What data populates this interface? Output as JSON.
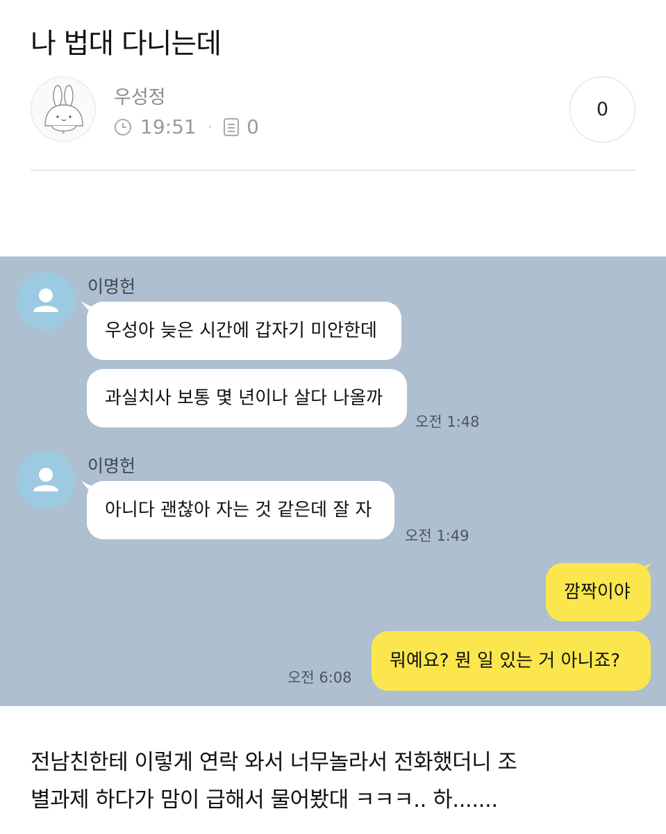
{
  "post": {
    "title": "나 법대 다니는데",
    "author": "우성정",
    "time": "19:51",
    "separator": "·",
    "views": "0",
    "comments": "0"
  },
  "chat": {
    "groups": [
      {
        "sender": "이명헌",
        "messages": [
          "우성아 늦은 시간에 갑자기 미안한데",
          "과실치사 보통 몇 년이나 살다 나올까"
        ],
        "time": "오전 1:48"
      },
      {
        "sender": "이명헌",
        "messages": [
          "아니다 괜찮아 자는 것 같은데 잘 자"
        ],
        "time": "오전 1:49"
      },
      {
        "sender": "me",
        "messages": [
          "깜짝이야",
          "뭐예요? 뭔 일 있는 거 아니죠?"
        ],
        "time": "오전 6:08"
      }
    ]
  },
  "caption": {
    "line1": "전남친한테 이렇게 연락 와서 너무놀라서 전화했더니 조",
    "line2": "별과제 하다가 맘이 급해서 물어봤대 ㅋㅋㅋ.. 하......."
  },
  "colors": {
    "chat_bg": "#aebfd0",
    "my_bubble": "#fbe74d",
    "their_bubble": "#ffffff",
    "profile_default": "#9ccbe1"
  },
  "icons": {
    "avatar": "bunny-avatar-icon",
    "clock": "clock-icon",
    "views": "document-icon",
    "profile": "default-profile-icon"
  }
}
